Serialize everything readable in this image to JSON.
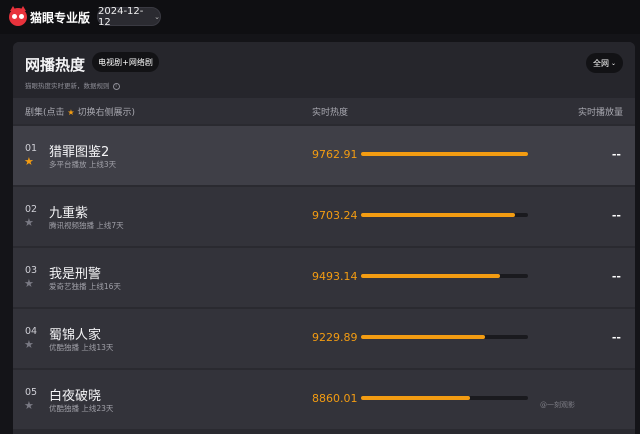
{
  "app": {
    "brand": "猫眼专业版",
    "date": "2024-12-12",
    "chevron": "⌄"
  },
  "panel": {
    "title": "网播热度",
    "type_filter": "电视剧+网络剧",
    "subtitle": "猫眼热度实时更新，数据规则",
    "scope": "全网",
    "columns": {
      "series_prefix": "剧集(点击",
      "series_suffix": "切换右侧展示)",
      "heat": "实时热度",
      "plays": "实时播放量"
    }
  },
  "rows": [
    {
      "rank": "01",
      "name": "猎罪图鉴2",
      "meta": "多平台播放  上线3天",
      "heat": "9762.91",
      "heat_fraction": 1.0,
      "plays": "--",
      "starred": true
    },
    {
      "rank": "02",
      "name": "九重紫",
      "meta": "腾讯视频独播  上线7天",
      "heat": "9703.24",
      "heat_fraction": 0.92,
      "plays": "--",
      "starred": false
    },
    {
      "rank": "03",
      "name": "我是刑警",
      "meta": "爱奇艺独播  上线16天",
      "heat": "9493.14",
      "heat_fraction": 0.83,
      "plays": "--",
      "starred": false
    },
    {
      "rank": "04",
      "name": "蜀锦人家",
      "meta": "优酷独播  上线13天",
      "heat": "9229.89",
      "heat_fraction": 0.74,
      "plays": "--",
      "starred": false
    },
    {
      "rank": "05",
      "name": "白夜破晓",
      "meta": "优酷独播  上线23天",
      "heat": "8860.01",
      "heat_fraction": 0.65,
      "plays": "",
      "starred": false
    }
  ],
  "watermark": "@一刻观影",
  "colors": {
    "accent": "#f39c12",
    "brand_red": "#e8323c"
  },
  "icons": {
    "logo": "cat-eye-logo-icon",
    "star": "star-icon",
    "info": "info-icon",
    "chevron": "chevron-down-icon"
  }
}
